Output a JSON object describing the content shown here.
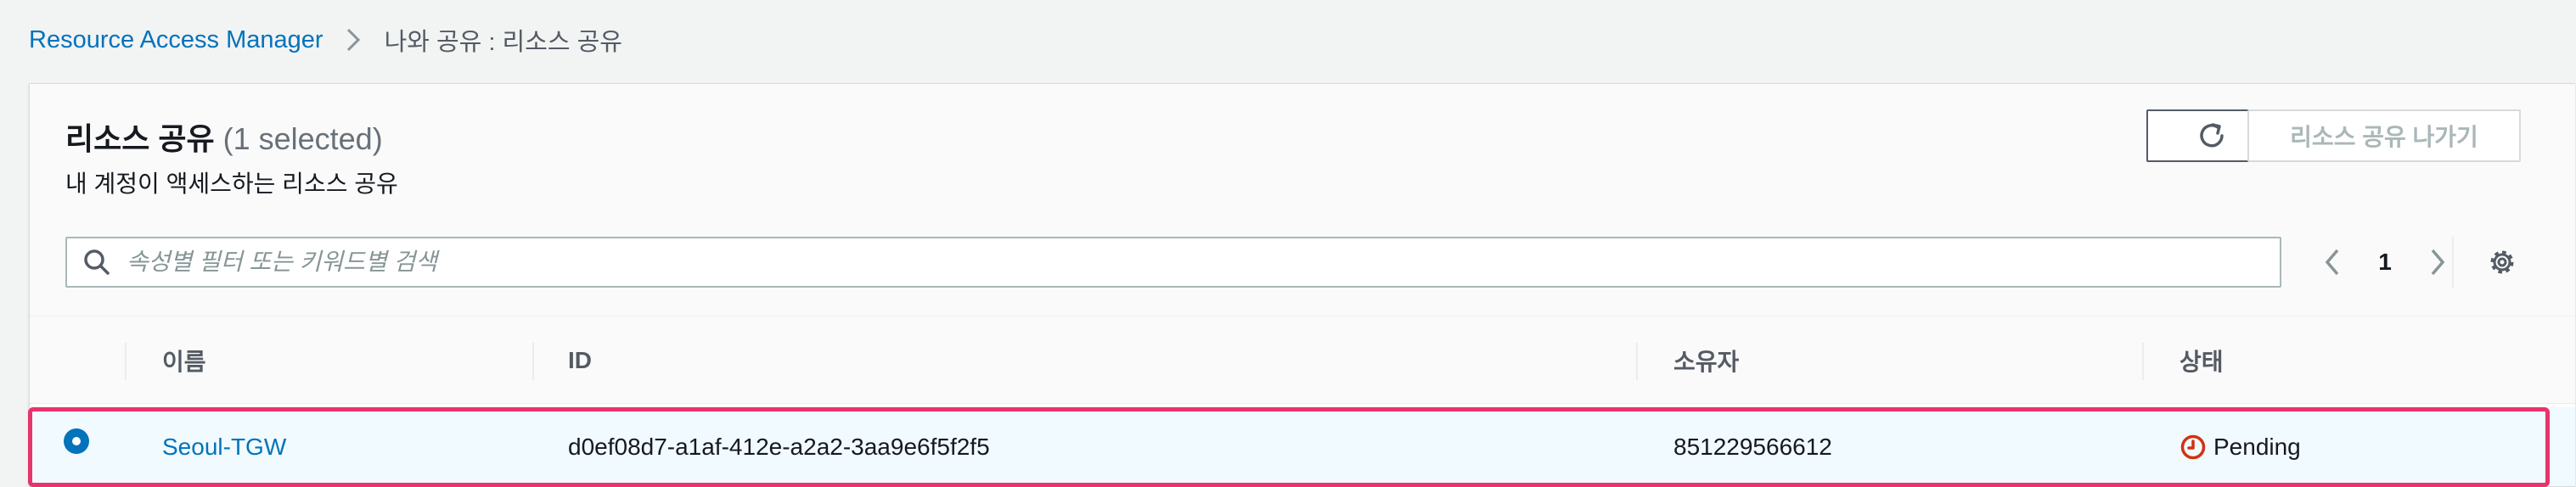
{
  "breadcrumb": {
    "root": "Resource Access Manager",
    "current": "나와 공유 : 리소스 공유"
  },
  "panel": {
    "title": "리소스 공유",
    "selected_count": "(1 selected)",
    "description": "내 계정이 액세스하는 리소스 공유",
    "leave_button": "리소스 공유 나가기"
  },
  "search": {
    "placeholder": "속성별 필터 또는 키워드별 검색",
    "value": ""
  },
  "pagination": {
    "current_page": "1"
  },
  "table": {
    "columns": [
      "이름",
      "ID",
      "소유자",
      "상태"
    ],
    "rows": [
      {
        "selected": true,
        "name": "Seoul-TGW",
        "id": "d0ef08d7-a1af-412e-a2a2-3aa9e6f5f2f5",
        "owner": "851229566612",
        "status": "Pending"
      }
    ]
  },
  "colors": {
    "link": "#0073bb",
    "highlight": "#e8336b",
    "pending": "#d13212",
    "selected_row_bg": "#f1faff"
  }
}
